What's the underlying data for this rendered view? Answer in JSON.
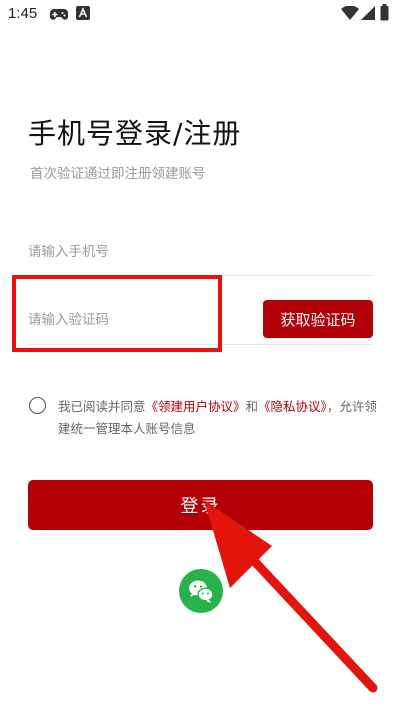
{
  "status_bar": {
    "time": "1:45",
    "icons": [
      "gamepad-icon",
      "app-a-icon",
      "wifi-icon",
      "signal-icon",
      "battery-icon"
    ]
  },
  "login": {
    "title": "手机号登录/注册",
    "subtitle": "首次验证通过即注册领建账号",
    "phone_placeholder": "请输入手机号",
    "code_placeholder": "请输入验证码",
    "get_code_label": "获取验证码",
    "agreement": {
      "prefix": "我已阅读并同意",
      "user_agreement": "《领建用户协议》",
      "and": "和",
      "privacy_agreement": "《隐私协议》",
      "suffix": "，允许领建统一管理本人账号信息"
    },
    "login_label": "登录",
    "wechat_icon": "wechat-icon"
  },
  "colors": {
    "accent": "#b30006",
    "annotation": "#e2140c",
    "wechat": "#27b34a"
  }
}
